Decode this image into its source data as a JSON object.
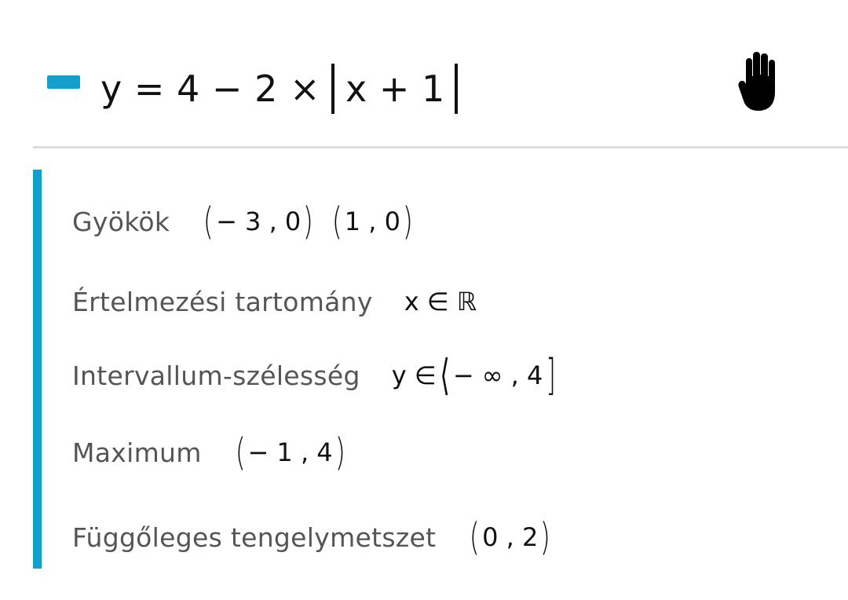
{
  "header": {
    "series_color": "#129fcb",
    "equation_lhs": "y = 4 − 2 ×",
    "equation_abs": "x + 1",
    "pan_icon": "hand-icon"
  },
  "panel": {
    "accent_color": "#129fcb",
    "rows": [
      {
        "label": "Gyökök",
        "value_a": "− 3 , 0",
        "value_b": "1 , 0"
      },
      {
        "label": "Értelmezési tartomány",
        "value": "x ∈ ℝ"
      },
      {
        "label": "Intervallum-szélesség",
        "value_prefix": "y ∈",
        "value_open": "⟨",
        "value_inner": "− ∞ , 4",
        "value_close": "]"
      },
      {
        "label": "Maximum",
        "value": "− 1 , 4"
      },
      {
        "label": "Függőleges tengelymetszet",
        "value": "0 , 2"
      }
    ]
  }
}
